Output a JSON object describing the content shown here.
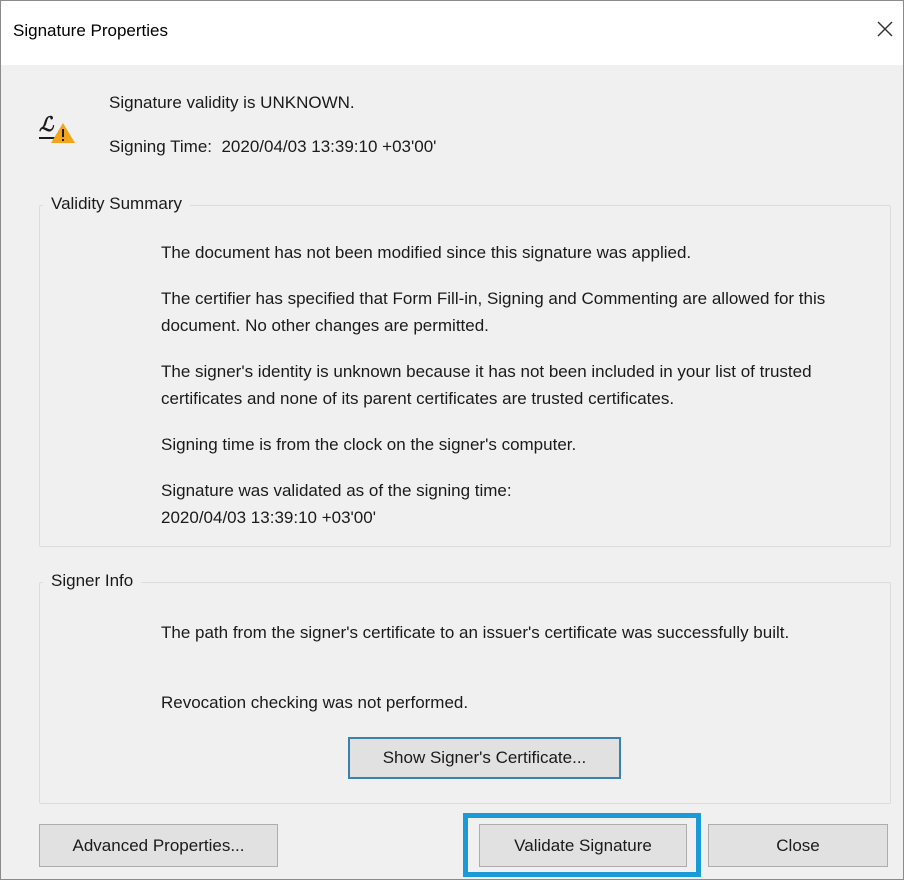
{
  "window": {
    "title": "Signature Properties",
    "close_glyph": "×"
  },
  "header": {
    "icon": "signature-warning-icon",
    "status": "Signature validity is UNKNOWN.",
    "signing_time_label": "Signing Time:",
    "signing_time_value": "2020/04/03 13:39:10 +03'00'"
  },
  "validity_summary": {
    "label": "Validity Summary",
    "paragraphs": [
      "The document has not been modified since this signature was applied.",
      "The certifier has specified that Form Fill-in, Signing and Commenting are allowed for this document. No other changes are permitted.",
      "The signer's identity is unknown because it has not been included in your list of trusted certificates and none of its parent certificates are trusted certificates.",
      "Signing time is from the clock on the signer's computer.",
      "Signature was validated as of the signing time:",
      "2020/04/03 13:39:10 +03'00'"
    ]
  },
  "signer_info": {
    "label": "Signer Info",
    "paragraphs": [
      "The path from the signer's certificate to an issuer's certificate was successfully built.",
      "Revocation checking was not performed."
    ],
    "show_certificate_label": "Show Signer's Certificate..."
  },
  "footer": {
    "advanced_label": "Advanced Properties...",
    "validate_label": "Validate Signature",
    "close_label": "Close"
  },
  "colors": {
    "dialog_bg": "#f0f0f0",
    "button_bg": "#e1e1e1",
    "focus_border": "#3c7fb1",
    "highlight": "#1a9ad6",
    "warning": "#f2a51a"
  }
}
